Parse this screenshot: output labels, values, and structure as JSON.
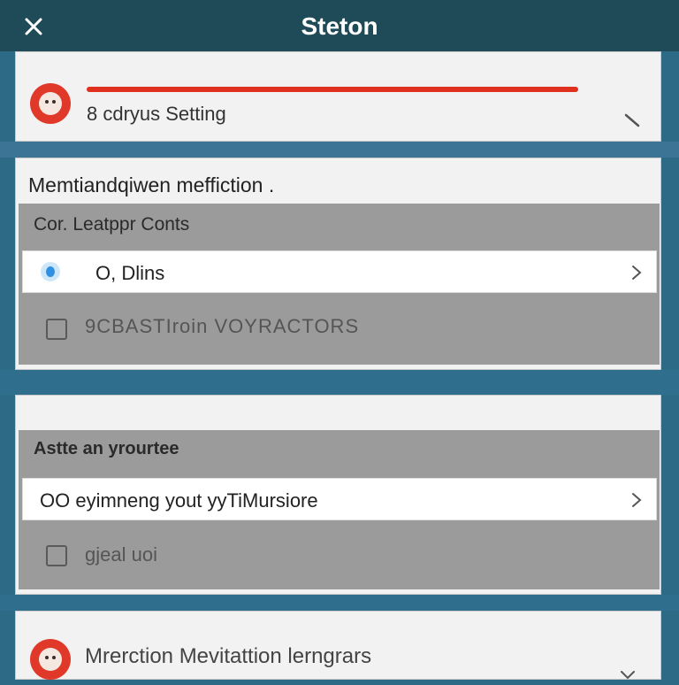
{
  "header": {
    "title": "Steton",
    "close_icon": "close-icon"
  },
  "profile": {
    "label": "8 cdryus Setting",
    "avatar_color": "#e0392a",
    "accent_line_color": "#e0301e"
  },
  "section1": {
    "heading": "Memtiandqiwen meffiction .",
    "group_label": "Cor. Leatppr Conts",
    "row": {
      "label": "O, Dlins"
    },
    "checkbox": {
      "label": "9CBASTIroin VOYRACTORS",
      "checked": false
    }
  },
  "section2": {
    "group_label": "Astte an yrourtee",
    "row": {
      "label": "OO eyimneng yout yyTiMursiore"
    },
    "checkbox": {
      "label": "gjeal uoi",
      "checked": false
    }
  },
  "bottom": {
    "label": "Mrerction  Mevitattion lerngrars"
  },
  "colors": {
    "header_bg": "#1f4b58",
    "page_bg": "#2c6a85",
    "card_bg": "#f2f2f2",
    "group_bg": "#9b9b9b",
    "radio_accent": "#2f8fe0"
  }
}
